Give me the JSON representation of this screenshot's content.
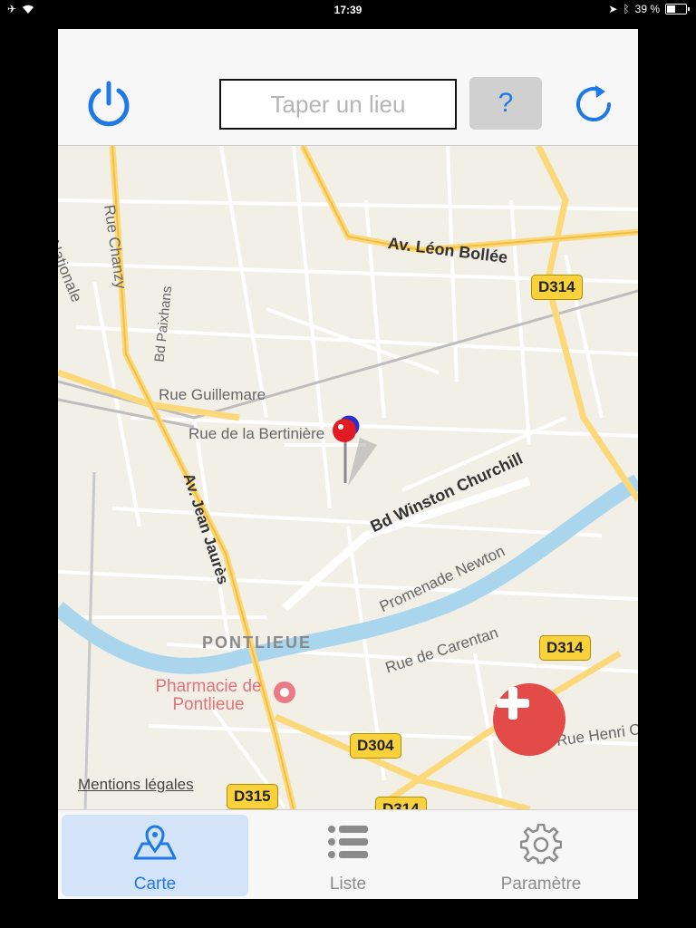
{
  "status_bar": {
    "time": "17:39",
    "battery": "39 %",
    "battery_level": 0.39
  },
  "header": {
    "power_icon": "power-icon",
    "search_placeholder": "Taper un lieu",
    "search_value": "",
    "help_label": "?",
    "refresh_icon": "refresh-icon"
  },
  "map": {
    "labels": {
      "nationale": "Nationale",
      "rue_chanzy": "Rue Chanzy",
      "bd_paixhans": "Bd Paixhans",
      "av_leon_bollee": "Av. Léon Bollée",
      "rue_guillemare": "Rue Guillemare",
      "rue_bertiniere": "Rue de la Bertinière",
      "bd_churchill": "Bd Winston Churchill",
      "av_jean_jaures": "Av. Jean Jaurès",
      "promenade_newton": "Promenade Newton",
      "pontlieue": "PONTLIEUE",
      "rue_carentan": "Rue de Carentan",
      "rue_henri": "Rue Henri Cha",
      "pharmacie": "Pharmacie de Pontlieue"
    },
    "shields": {
      "d314_a": "D314",
      "d314_b": "D314",
      "d314_c": "D314",
      "d304": "D304",
      "d315": "D315"
    },
    "legal": "Mentions légales"
  },
  "tabs": [
    {
      "label": "Carte",
      "icon": "map-pin-icon",
      "active": true
    },
    {
      "label": "Liste",
      "icon": "list-icon",
      "active": false
    },
    {
      "label": "Paramètre",
      "icon": "gear-icon",
      "active": false
    }
  ],
  "colors": {
    "accent": "#1e78e6",
    "fab": "#e24b48",
    "water": "#a9d6ed",
    "major_road": "#fbd97a",
    "map_bg": "#f2efe7"
  }
}
